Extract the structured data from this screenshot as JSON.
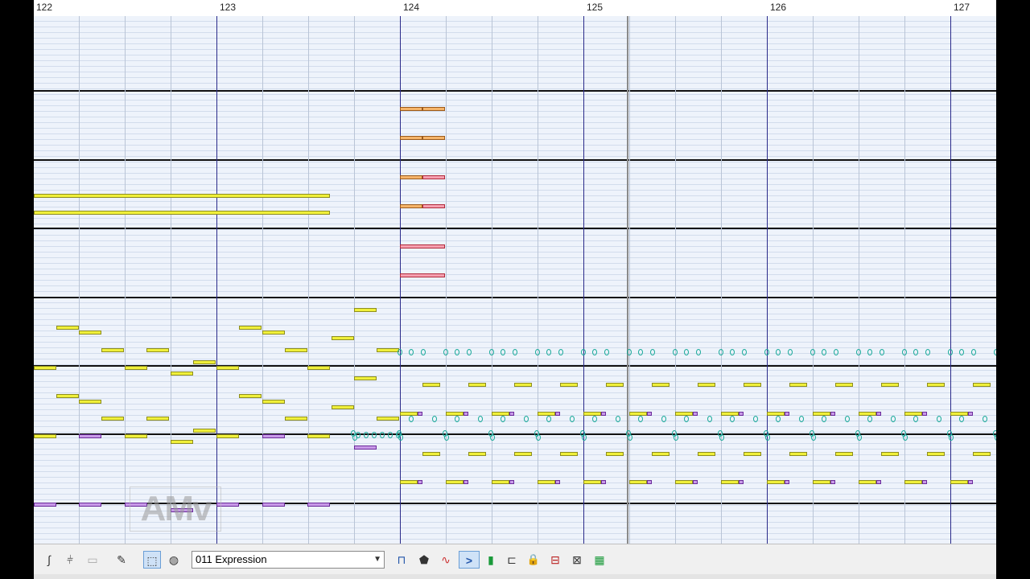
{
  "ruler": {
    "bars": [
      "122",
      "123",
      "124",
      "125",
      "126",
      "127"
    ]
  },
  "watermark": {
    "text": "AMv"
  },
  "toolbar": {
    "controller_select": {
      "selected": "011 Expression"
    },
    "tools": [
      {
        "name": "pencil-curve-icon",
        "glyph": "∫"
      },
      {
        "name": "waveform-tool-icon",
        "glyph": "⫩"
      },
      {
        "name": "eraser-tool-icon",
        "glyph": "▭"
      },
      {
        "name": "smart-pencil-icon",
        "glyph": "✎"
      },
      {
        "name": "select-range-icon",
        "glyph": "⬚"
      },
      {
        "name": "paint-fill-icon",
        "glyph": "◍"
      }
    ],
    "right_tools": [
      {
        "name": "piano-roll-view-icon",
        "glyph": "⊓"
      },
      {
        "name": "stamp-tool-icon",
        "glyph": "⬟"
      },
      {
        "name": "curve-edit-icon",
        "glyph": "∿"
      },
      {
        "name": "greater-than-icon",
        "glyph": ">"
      },
      {
        "name": "level-meter-icon",
        "glyph": "▮"
      },
      {
        "name": "bracket-tool-icon",
        "glyph": "⊏"
      },
      {
        "name": "lock-icon",
        "glyph": "🔒"
      },
      {
        "name": "split-icon",
        "glyph": "⊟"
      },
      {
        "name": "envelope-icon",
        "glyph": "⊠"
      },
      {
        "name": "mixer-icon",
        "glyph": "▦"
      }
    ]
  },
  "colors": {
    "note_yellow": "#f0f03a",
    "note_orange": "#f5b46a",
    "note_red": "#f6a0b0",
    "note_purple": "#c89ae8",
    "event_teal": "#1aaa9a",
    "bar_line": "#2a2a8a"
  }
}
